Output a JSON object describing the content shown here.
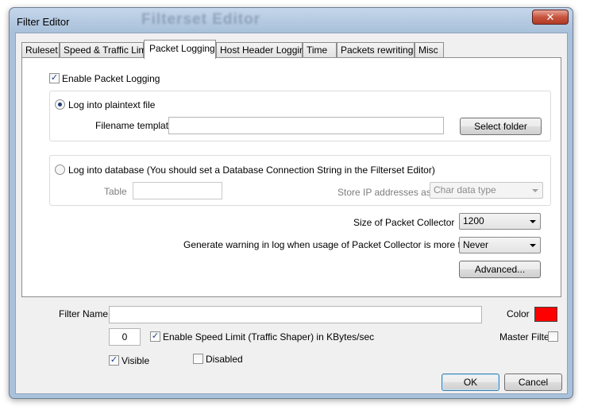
{
  "window": {
    "title": "Filter Editor",
    "background_title": "Filterset Editor",
    "close_glyph": "✕"
  },
  "tabs": [
    "Ruleset",
    "Speed & Traffic Limit",
    "Packet Logging",
    "Host Header Logging",
    "Time",
    "Packets rewriting",
    "Misc"
  ],
  "active_tab": "Packet Logging",
  "packet_logging": {
    "enable_label": "Enable Packet Logging",
    "enable_checked": true,
    "plaintext": {
      "radio_label": "Log into plaintext file",
      "selected": true,
      "filename_label": "Filename template",
      "filename_value": "",
      "select_folder_label": "Select folder"
    },
    "database": {
      "radio_label": "Log into database (You should set a Database Connection String in the Filterset Editor)",
      "selected": false,
      "table_label": "Table",
      "table_value": "",
      "store_ip_label": "Store IP addresses as",
      "store_ip_value": "Char data type"
    },
    "collector_size_label": "Size of Packet Collector",
    "collector_size_value": "1200",
    "warning_label": "Generate warning in log when usage of Packet Collector is more than",
    "warning_value": "Never",
    "advanced_label": "Advanced..."
  },
  "bottom": {
    "filter_name_label": "Filter Name",
    "filter_name_value": "",
    "color_label": "Color",
    "color_value": "#ff0000",
    "speed_value": "0",
    "speed_limit_label": "Enable Speed Limit (Traffic Shaper) in KBytes/sec",
    "speed_limit_checked": true,
    "master_filter_label": "Master Filter",
    "master_filter_checked": false,
    "visible_label": "Visible",
    "visible_checked": true,
    "disabled_label": "Disabled",
    "disabled_checked": false,
    "ok_label": "OK",
    "cancel_label": "Cancel"
  }
}
